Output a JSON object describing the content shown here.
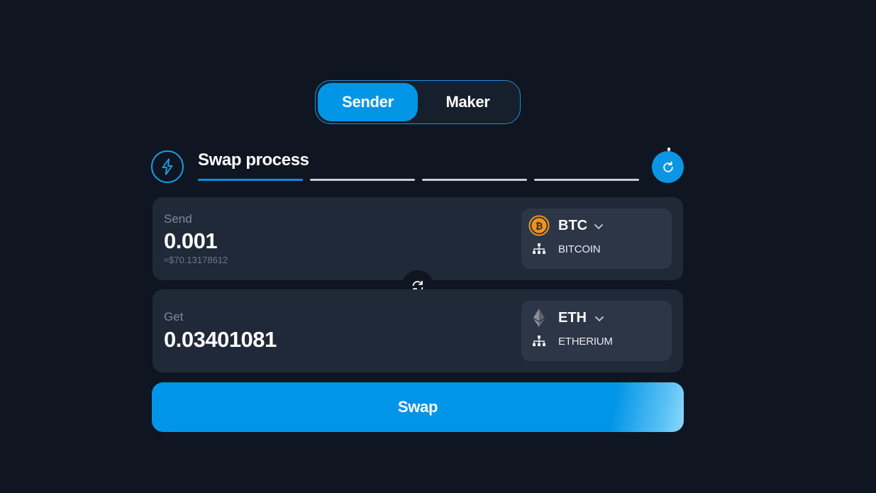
{
  "role_toggle": {
    "sender_label": "Sender",
    "maker_label": "Maker",
    "active": "Sender"
  },
  "header": {
    "title": "Swap process",
    "steps_total": 4,
    "steps_active": 1
  },
  "send": {
    "label": "Send",
    "amount": "0.001",
    "fiat": "≈$70.13178612",
    "token_symbol": "BTC",
    "network": "BITCOIN",
    "icon": "bitcoin-icon"
  },
  "get": {
    "label": "Get",
    "amount": "0.03401081",
    "token_symbol": "ETH",
    "network": "ETHERIUM",
    "icon": "ethereum-icon"
  },
  "swap_button": {
    "label": "Swap"
  },
  "colors": {
    "background": "#0f1621",
    "card": "#1f2938",
    "token_select": "#2c3646",
    "accent": "#0096e6",
    "bitcoin": "#f7931a"
  }
}
